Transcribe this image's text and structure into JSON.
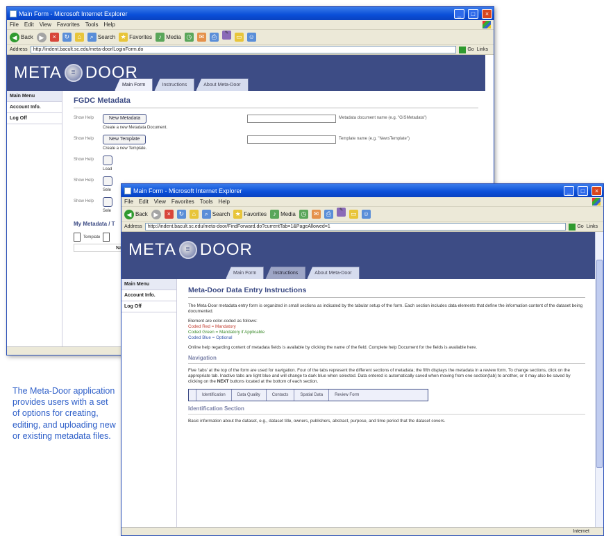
{
  "window_back": {
    "title": "Main Form - Microsoft Internet Explorer",
    "menu": [
      "File",
      "Edit",
      "View",
      "Favorites",
      "Tools",
      "Help"
    ],
    "toolbar": [
      "Back",
      "Search",
      "Favorites",
      "Media"
    ],
    "address_label": "Address",
    "address": "http://indent.bacult.sc.edu/meta-door/LoginForm.do",
    "go": "Go",
    "links": "Links",
    "logo": {
      "left": "META",
      "right": "DOOR"
    },
    "tabs": [
      "Main Form",
      "Instructions",
      "About Meta-Door"
    ],
    "active_tab": 0,
    "sidebar": [
      "Main Menu",
      "Account Info.",
      "Log Off"
    ],
    "heading": "FGDC Metadata",
    "rows": [
      {
        "help": "Show Help",
        "button": "New Metadata",
        "caption": "Create a new Metadata Document.",
        "hint": "Metadata document name (e.g. \"GISMetadata\")"
      },
      {
        "help": "Show Help",
        "button": "New Template",
        "caption": "Create a new Template.",
        "hint": "Template name (e.g. \"NewsTemplate\")"
      },
      {
        "help": "Show Help",
        "caption": "Load"
      },
      {
        "help": "Show Help",
        "caption": "Sele"
      },
      {
        "help": "Show Help",
        "caption": "Sele"
      }
    ],
    "subheading": "My Metadata / T",
    "template_label": "Template",
    "name_label": "Name"
  },
  "window_front": {
    "title": "Main Form - Microsoft Internet Explorer",
    "menu": [
      "File",
      "Edit",
      "View",
      "Favorites",
      "Tools",
      "Help"
    ],
    "toolbar": [
      "Back",
      "Search",
      "Favorites",
      "Media"
    ],
    "address_label": "Address",
    "address": "http://indent.bacult.sc.edu/meta-door/FindForward.do?currentTab=1&PageAllowed=1",
    "go": "Go",
    "links": "Links",
    "logo": {
      "left": "META",
      "right": "DOOR"
    },
    "tabs": [
      "Main Form",
      "Instructions",
      "About Meta-Door"
    ],
    "active_tab": 1,
    "sidebar": [
      "Main Menu",
      "Account Info.",
      "Log Off"
    ],
    "heading": "Meta-Door Data Entry Instructions",
    "intro": "The Meta-Door metadata entry form is organized in small sections as indicated by the tabular setup of the form. Each section includes data elements that define the information content of the dataset being documented.",
    "color_intro": "Element are color-coded as follows:",
    "color_red": "Coded Red = Mandatory",
    "color_green": "Coded Green = Mandatory if Applicable",
    "color_blue": "Coded Blue = Optional",
    "online_help": "Online help regarding content of metadata fields is available by clicking the name of the field. Complete help Document for the fields is available here.",
    "nav_heading": "Navigation",
    "nav_text_a": "Five 'tabs' at the top of the form are used for navigation. Four of the tabs represent the different sections of metadata; the fifth displays the metadata in a review form. To change sections, click on the appropriate tab. Inactive tabs are light blue and will change to dark blue when selected. Data entered is automatically saved when moving from one section(tab) to another, or it may also be saved by clicking on the",
    "nav_next": "NEXT",
    "nav_text_b": "buttons located at the bottom of each section.",
    "nav_tabs": [
      "Identification",
      "Data Quality",
      "Contacts",
      "Spatial Data",
      "Review Form"
    ],
    "id_heading": "Identification Section",
    "id_text": "Basic information about the dataset, e.g., dataset title, owners, publishers, abstract, purpose, and time period that the dataset covers.",
    "status": "Internet"
  },
  "caption": "The Meta-Door application provides users with a set of options for creating, editing, and uploading new or existing metadata files.",
  "colors": {
    "banner": "#3d4c85",
    "titlebar": "#0a4fd8",
    "caption": "#2d5ec8"
  }
}
